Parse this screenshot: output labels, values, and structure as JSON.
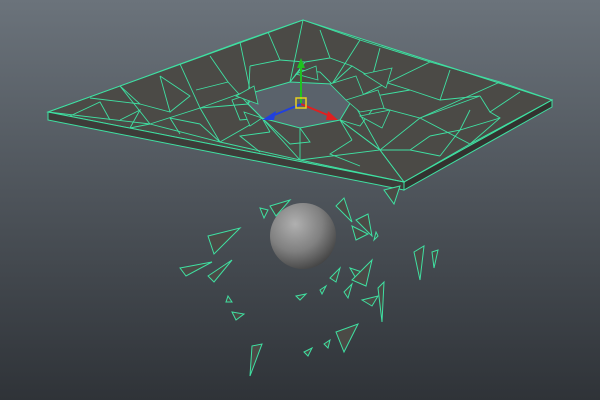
{
  "app": {
    "name": "3D viewport",
    "background_top": "#6b737b",
    "background_bottom": "#2f3338"
  },
  "scene": {
    "wireframe_color": "#3fe0a2",
    "face_color": "#4b4a46",
    "sphere_color": "#8a8a8a",
    "gizmo": {
      "x_color": "#e02020",
      "y_color": "#20c020",
      "z_color": "#2040e0",
      "center_color": "#e8d020"
    }
  },
  "icons": {
    "manipulator": "move-manipulator-icon"
  }
}
